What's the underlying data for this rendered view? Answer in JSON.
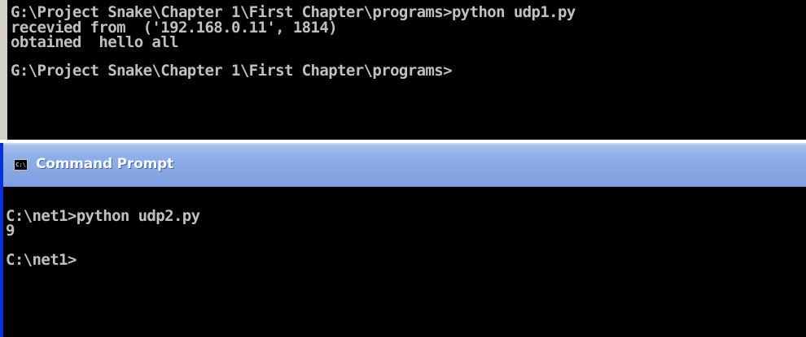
{
  "top_console": {
    "lines": [
      "G:\\Project Snake\\Chapter 1\\First Chapter\\programs>python udp1.py",
      "recevied from  ('192.168.0.11', 1814)",
      "obtained  hello all",
      "G:\\Project Snake\\Chapter 1\\First Chapter\\programs>"
    ]
  },
  "bottom_window": {
    "title": "Command Prompt",
    "icon": "cmd-icon",
    "icon_glyph": "C:\\",
    "lines": [
      "C:\\net1>python udp2.py",
      "9",
      "C:\\net1>"
    ]
  },
  "colors": {
    "console_bg": "#000000",
    "console_text": "#c0c0c0",
    "titlebar": "#87a8e4",
    "title_text": "#ffffff"
  }
}
